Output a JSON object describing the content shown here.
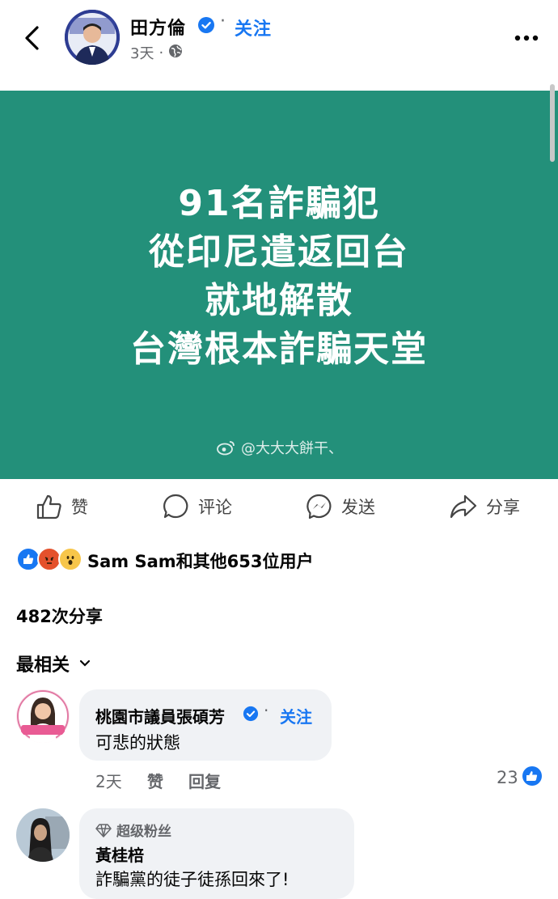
{
  "header": {
    "author": "田方倫",
    "follow": "关注",
    "dot": "·",
    "time": "3天",
    "meta_dot": "·"
  },
  "post": {
    "lines": [
      "91名詐騙犯",
      "從印尼遣返回台",
      "就地解散",
      "台灣根本詐騙天堂"
    ],
    "watermark": "@大大大餅干、",
    "background": "#23907a"
  },
  "actions": {
    "like": "赞",
    "comment": "评论",
    "send": "发送",
    "share": "分享"
  },
  "reactions": {
    "summary": "Sam Sam和其他653位用户",
    "types": [
      "like",
      "angry",
      "wow"
    ]
  },
  "shares": "482次分享",
  "sort": "最相关",
  "comments": [
    {
      "name": "桃園市議員張碩芳",
      "follow": "关注",
      "dot": "·",
      "text": "可悲的狀態",
      "time": "2天",
      "like": "赞",
      "reply": "回复",
      "likes": "23"
    },
    {
      "badge": "超级粉丝",
      "name": "黃桂棓",
      "text": "詐騙黨的徒子徒孫回來了!"
    }
  ],
  "colors": {
    "accent": "#1877f2",
    "muted": "#65676b",
    "bubble": "#f0f2f5"
  }
}
